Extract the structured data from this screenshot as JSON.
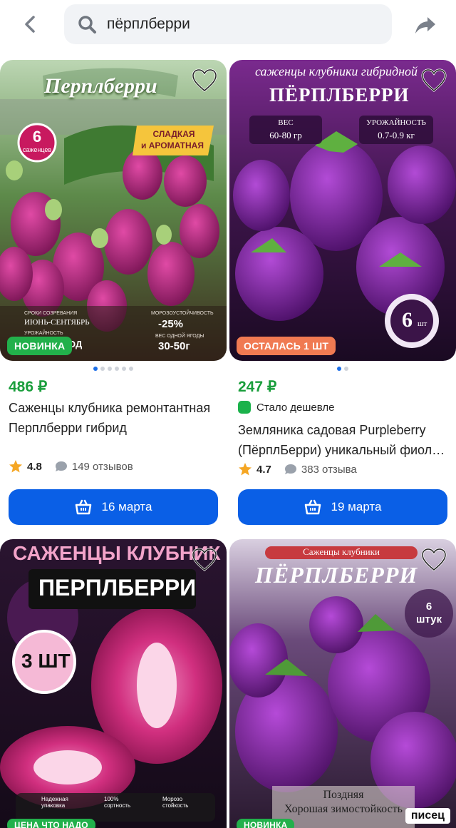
{
  "search": {
    "value": "пёрплберри"
  },
  "products": [
    {
      "badge": "НОВИНКА",
      "price": "486 ₽",
      "title": "Саженцы клубника ремонтантная Перплберри гибрид",
      "rating": "4.8",
      "reviews": "149 отзывов",
      "delivery": "16 марта",
      "image_text": {
        "brand": "Перплберри",
        "count_num": "6",
        "count_word": "саженцев",
        "tag1": "СЛАДКАЯ",
        "tag2": "и АРОМАТНАЯ",
        "ripen_label": "СРОКИ СОЗРЕВАНИЯ",
        "ripen_value": "ИЮНЬ-СЕНТЯБРЬ",
        "yield_label": "УРОЖАЙНОСТЬ",
        "frost_label": "МОРОЗОУСТОЙЧИВОСТЬ",
        "frost_value": "-25%",
        "weight_label": "ВЕС ОДНОЙ ЯГОДЫ",
        "weight_value": "30-50г",
        "yield_value": "ОД"
      }
    },
    {
      "badge": "ОСТАЛАСЬ 1 ШТ",
      "price": "247 ₽",
      "cheaper": "Стало дешевле",
      "title": "Земляника садовая Purpleberry (ПёрплБерри) уникальный фиол…",
      "rating": "4.7",
      "reviews": "383 отзыва",
      "delivery": "19 марта",
      "image_text": {
        "top": "саженцы клубники гибридной",
        "brand": "ПЁРПЛБЕРРИ",
        "weight_label": "ВЕС",
        "weight_value": "60-80 гр",
        "yield_label": "УРОЖАЙНОСТЬ",
        "yield_value": "0.7-0.9 кг",
        "count": "6",
        "count_unit": "шт"
      }
    },
    {
      "badge": "ЦЕНА ЧТО НАДО",
      "image_text": {
        "line1": "САЖЕНЦЫ КЛУБНИК",
        "line2": "ПЕРПЛБЕРРИ",
        "count": "3 ШТ",
        "f1": "Надежная упаковка",
        "f2": "100% сортность",
        "f3": "Морозо стойкость"
      }
    },
    {
      "badge": "НОВИНКА",
      "image_text": {
        "top": "Саженцы клубники",
        "brand": "ПЁРПЛБЕРРИ",
        "count_num": "6",
        "count_word": "штук",
        "late": "Поздняя",
        "winter": "Хорошая зимостойкость"
      }
    }
  ],
  "watermark": "писец",
  "colors": {
    "price": "#1a9e3c",
    "button": "#0a5fe6",
    "badge_new": "#22b04b",
    "badge_left": "#f07a52"
  }
}
